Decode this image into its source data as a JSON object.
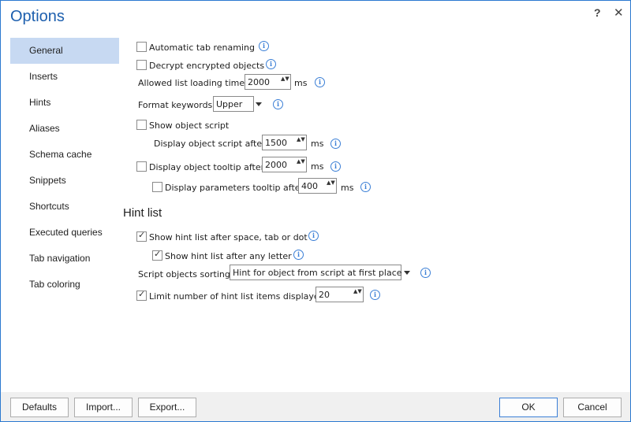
{
  "window": {
    "title": "Options",
    "help_glyph": "?",
    "close_glyph": "✕"
  },
  "nav": {
    "items": [
      {
        "label": "General",
        "selected": true
      },
      {
        "label": "Inserts"
      },
      {
        "label": "Hints"
      },
      {
        "label": "Aliases"
      },
      {
        "label": "Schema cache"
      },
      {
        "label": "Snippets"
      },
      {
        "label": "Shortcuts"
      },
      {
        "label": "Executed queries"
      },
      {
        "label": "Tab navigation"
      },
      {
        "label": "Tab coloring"
      }
    ]
  },
  "general": {
    "auto_tab_renaming": {
      "label": "Automatic tab renaming",
      "checked": false
    },
    "decrypt_objects": {
      "label": "Decrypt encrypted objects",
      "checked": false
    },
    "list_loading_time": {
      "label": "Allowed list loading time:",
      "value": "2000",
      "unit": "ms"
    },
    "format_keywords": {
      "label": "Format keywords:",
      "value": "Upper"
    },
    "show_object_script": {
      "label": "Show object script",
      "checked": false
    },
    "object_script_after": {
      "label": "Display object script after:",
      "value": "1500",
      "unit": "ms"
    },
    "object_tooltip": {
      "label": "Display object tooltip after:",
      "checked": false,
      "value": "2000",
      "unit": "ms"
    },
    "params_tooltip": {
      "label": "Display parameters tooltip after:",
      "checked": false,
      "value": "400",
      "unit": "ms"
    }
  },
  "hint_list": {
    "title": "Hint list",
    "show_after_space": {
      "label": "Show hint list after space, tab or dot",
      "checked": true
    },
    "show_after_letter": {
      "label": "Show hint list after any letter",
      "checked": true
    },
    "sorting": {
      "label": "Script objects sorting:",
      "value": "Hint for object from script at first place"
    },
    "limit_items": {
      "label": "Limit number of hint list items displayed:",
      "checked": true,
      "value": "20"
    }
  },
  "footer": {
    "defaults": "Defaults",
    "import": "Import...",
    "export": "Export...",
    "ok": "OK",
    "cancel": "Cancel"
  },
  "icons": {
    "info_glyph": "i",
    "check_glyph": "✓",
    "spin_glyph": "▲▼"
  },
  "colors": {
    "accent": "#1d5fae",
    "selection": "#c7d9f2",
    "border": "#2b79d0"
  }
}
